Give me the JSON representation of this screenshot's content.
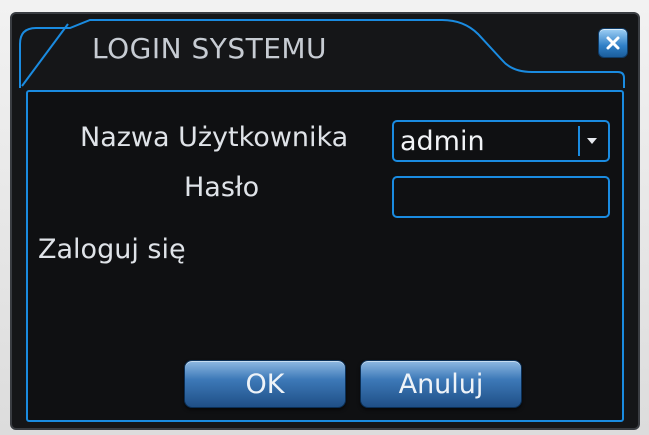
{
  "dialog": {
    "title": "LOGIN SYSTEMU",
    "close_icon": "close-icon"
  },
  "form": {
    "username_label": "Nazwa Użytkownika",
    "username_value": "admin",
    "password_label": "Hasło",
    "password_value": "",
    "status_text": "Zaloguj się"
  },
  "buttons": {
    "ok_label": "OK",
    "cancel_label": "Anuluj"
  },
  "colors": {
    "accent": "#1a8be0",
    "window_bg": "#151618",
    "text": "#dfe3e8"
  }
}
